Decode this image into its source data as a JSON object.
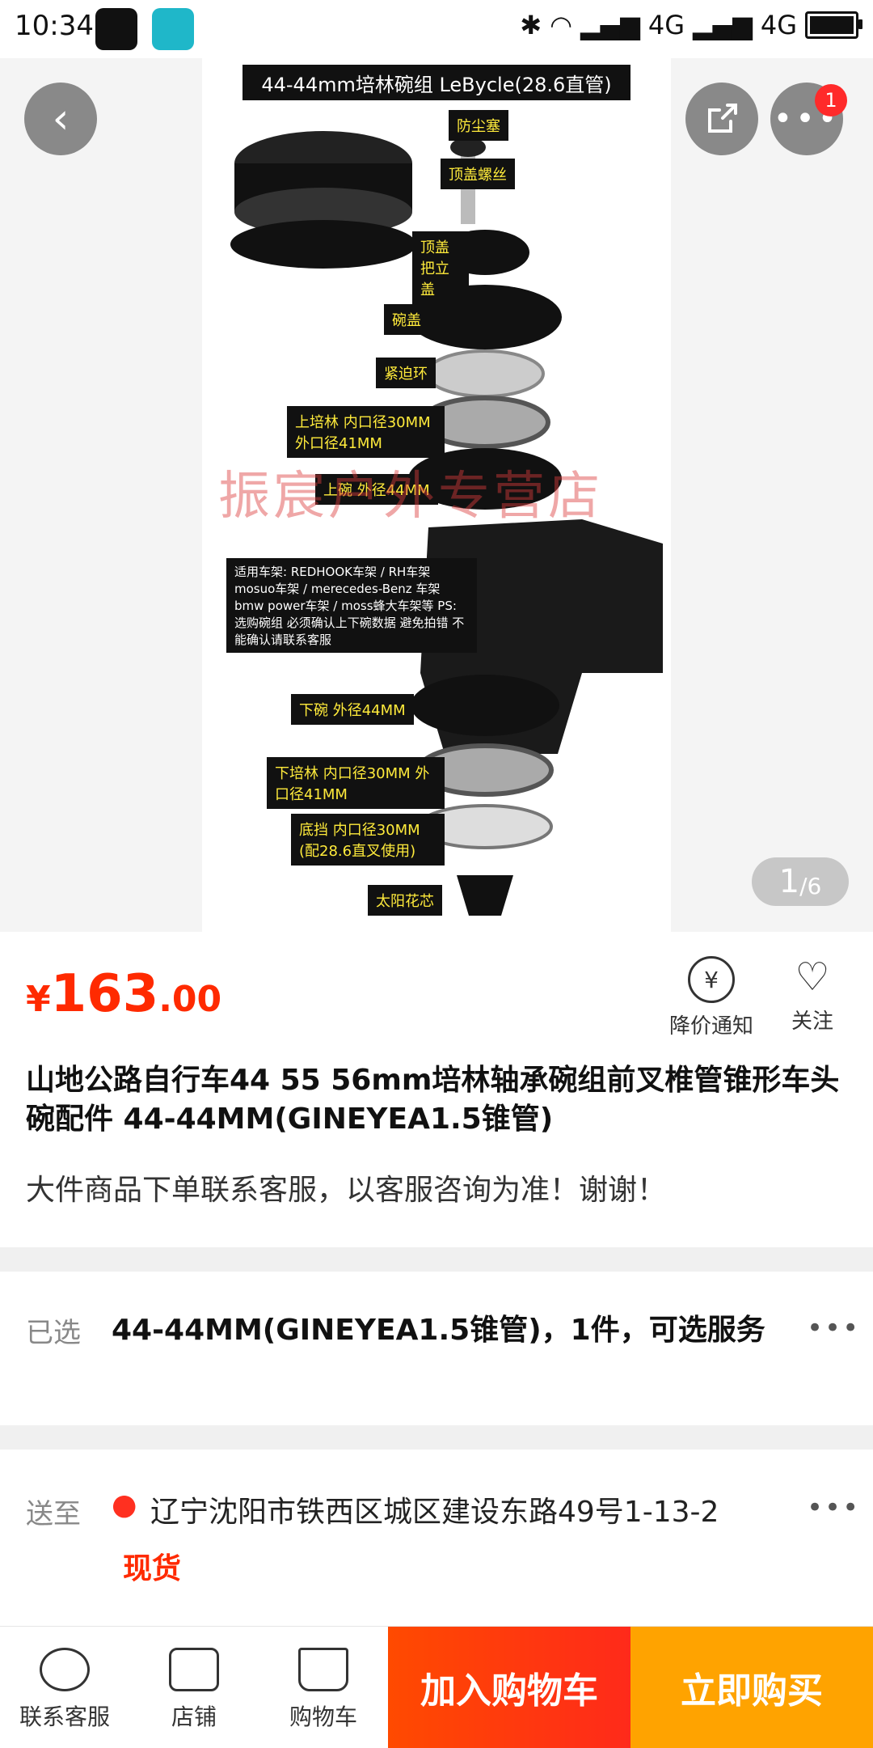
{
  "status_bar": {
    "time": "10:34",
    "network": "4G",
    "network2": "4G"
  },
  "hero": {
    "poster_title": "44-44mm培林碗组 LeBycle(28.6直管)",
    "watermark": "振宸户外专营店",
    "labels": [
      "防尘塞",
      "顶盖螺丝",
      "顶盖 把立盖",
      "碗盖",
      "紧迫环",
      "上培林 内口径30MM 外口径41MM",
      "上碗 外径44MM",
      "适用车架: REDHOOK车架 / RH车架 mosuo车架 / merecedes-Benz 车架 bmw power车架 / moss蜂大车架等 PS: 选购碗组 必须确认上下碗数据 避免拍错 不能确认请联系客服",
      "下碗 外径44MM",
      "下培林 内口径30MM 外口径41MM",
      "底挡 内口径30MM (配28.6直叉使用)",
      "太阳花芯"
    ],
    "counter_current": "1",
    "counter_total": "/6",
    "badge_count": "1"
  },
  "price": {
    "symbol": "¥",
    "integer": "163",
    "decimal": ".00",
    "color": "#ff2a00"
  },
  "actions": {
    "notify": "降价通知",
    "follow": "关注"
  },
  "product": {
    "title": "山地公路自行车44 55 56mm培林轴承碗组前叉椎管锥形车头碗配件 44-44MM(GINEYEA1.5锥管)",
    "subtitle": "大件商品下单联系客服，以客服咨询为准！谢谢！"
  },
  "selected": {
    "label": "已选",
    "value": "44-44MM(GINEYEA1.5锥管)，1件，可选服务"
  },
  "delivery": {
    "label": "送至",
    "address": "辽宁沈阳市铁西区城区建设东路49号1-13-2",
    "stock": "现货"
  },
  "bottom_bar": {
    "tabs": [
      "联系客服",
      "店铺",
      "购物车"
    ],
    "add_cart": "加入购物车",
    "buy_now": "立即购买"
  },
  "icons": [
    "back-icon",
    "share-icon",
    "more-icon",
    "yen-bell-icon",
    "heart-icon",
    "location-pin-icon",
    "chat-icon",
    "store-icon",
    "cart-icon"
  ]
}
